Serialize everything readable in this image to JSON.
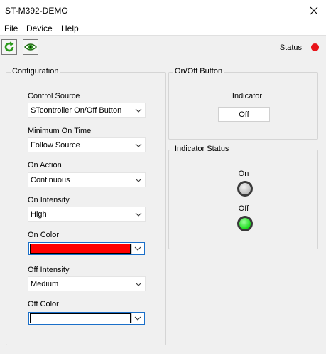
{
  "window": {
    "title": "ST-M392-DEMO"
  },
  "menu": {
    "items": [
      "File",
      "Device",
      "Help"
    ]
  },
  "toolbar": {
    "refresh_icon": "refresh-icon",
    "view_icon": "eye-icon",
    "status_label": "Status",
    "status_color": "#e8141a"
  },
  "configuration": {
    "title": "Configuration",
    "control_source": {
      "label": "Control Source",
      "value": "STcontroller On/Off Button"
    },
    "minimum_on_time": {
      "label": "Minimum On Time",
      "value": "Follow Source"
    },
    "on_action": {
      "label": "On Action",
      "value": "Continuous"
    },
    "on_intensity": {
      "label": "On Intensity",
      "value": "High"
    },
    "on_color": {
      "label": "On Color",
      "color": "#ff0000"
    },
    "off_intensity": {
      "label": "Off Intensity",
      "value": "Medium"
    },
    "off_color": {
      "label": "Off Color",
      "color": "#ffffff"
    }
  },
  "onoff_button": {
    "title": "On/Off Button",
    "indicator_label": "Indicator",
    "button_label": "Off"
  },
  "indicator_status": {
    "title": "Indicator Status",
    "on_label": "On",
    "on_color": "#c8c8c8",
    "off_label": "Off",
    "off_color": "#22dd22"
  }
}
